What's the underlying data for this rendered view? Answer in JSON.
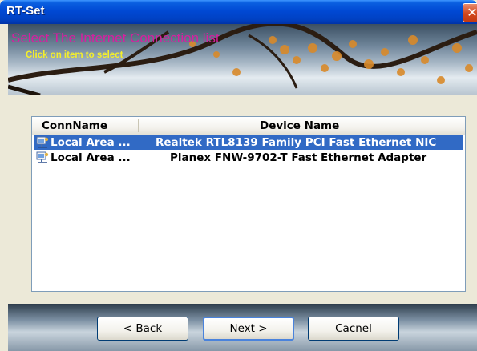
{
  "window": {
    "title": "RT-Set",
    "close_glyph": "✕"
  },
  "banner": {
    "title": "Select The Internet Connection list",
    "subtitle": "Click on item to select"
  },
  "list": {
    "columns": [
      "ConnName",
      "Device Name"
    ],
    "rows": [
      {
        "conn_name": "Local Area ...",
        "device_name": "Realtek RTL8139 Family PCI Fast Ethernet NIC",
        "selected": true,
        "icon": "network-connection-icon"
      },
      {
        "conn_name": "Local Area ...",
        "device_name": "Planex FNW-9702-T Fast Ethernet Adapter",
        "selected": false,
        "icon": "network-connection-icon"
      }
    ]
  },
  "buttons": {
    "back": "< Back",
    "next": "Next >",
    "cancel": "Cacnel"
  },
  "colors": {
    "title_bar": "#0049d4",
    "banner_title": "#d61fa0",
    "banner_subtitle": "#f4ef2a",
    "selection": "#316ac5"
  }
}
